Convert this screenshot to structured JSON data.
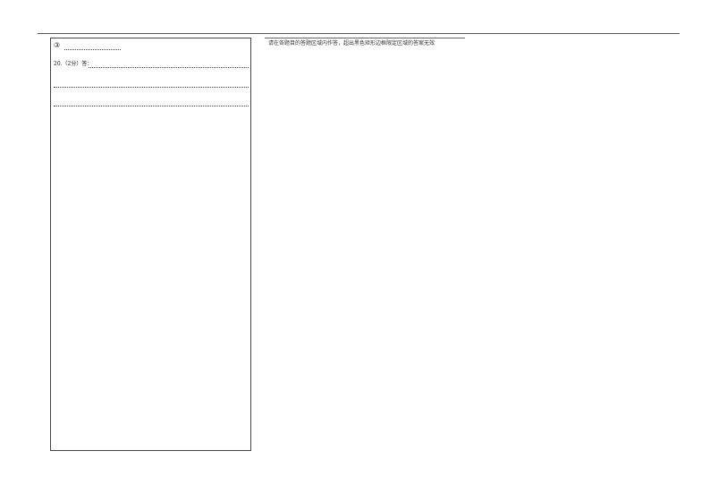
{
  "left_panel": {
    "item_marker": "③",
    "question": "20.（2分）答："
  },
  "right_panel": {
    "notice": "请在各题目的答题区域内作答，超出黑色矩形边框限定区域的答案无效"
  }
}
